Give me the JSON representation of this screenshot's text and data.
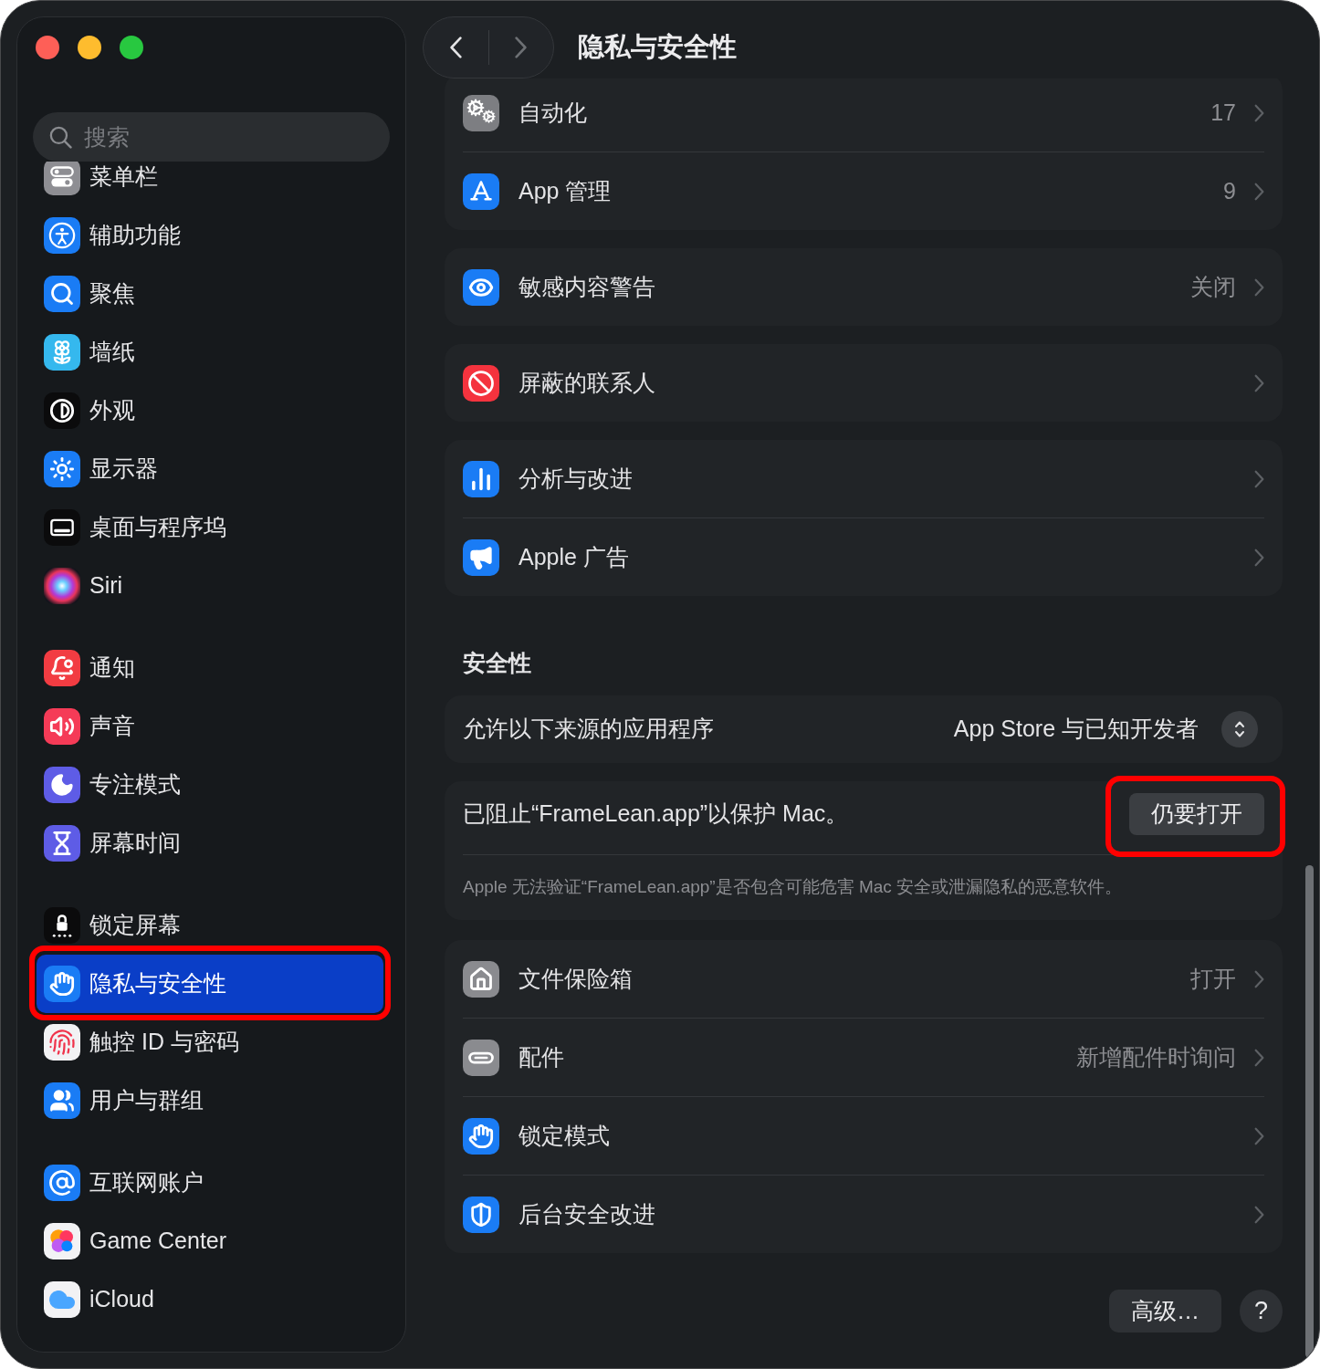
{
  "window": {
    "title": "隐私与安全性"
  },
  "sidebar": {
    "search": {
      "placeholder": "搜索"
    },
    "groups": [
      {
        "items": [
          {
            "label": "菜单栏",
            "selected": false,
            "highlighted": false
          },
          {
            "label": "辅助功能",
            "selected": false,
            "highlighted": false
          },
          {
            "label": "聚焦",
            "selected": false,
            "highlighted": false
          },
          {
            "label": "墙纸",
            "selected": false,
            "highlighted": false
          },
          {
            "label": "外观",
            "selected": false,
            "highlighted": false
          },
          {
            "label": "显示器",
            "selected": false,
            "highlighted": false
          },
          {
            "label": "桌面与程序坞",
            "selected": false,
            "highlighted": false
          },
          {
            "label": "Siri",
            "selected": false,
            "highlighted": false
          }
        ]
      },
      {
        "items": [
          {
            "label": "通知",
            "selected": false,
            "highlighted": false
          },
          {
            "label": "声音",
            "selected": false,
            "highlighted": false
          },
          {
            "label": "专注模式",
            "selected": false,
            "highlighted": false
          },
          {
            "label": "屏幕时间",
            "selected": false,
            "highlighted": false
          }
        ]
      },
      {
        "items": [
          {
            "label": "锁定屏幕",
            "selected": false,
            "highlighted": false
          },
          {
            "label": "隐私与安全性",
            "selected": true,
            "highlighted": true
          },
          {
            "label": "触控 ID 与密码",
            "selected": false,
            "highlighted": false
          },
          {
            "label": "用户与群组",
            "selected": false,
            "highlighted": false
          }
        ]
      },
      {
        "items": [
          {
            "label": "互联网账户",
            "selected": false,
            "highlighted": false
          },
          {
            "label": "Game Center",
            "selected": false,
            "highlighted": false
          },
          {
            "label": "iCloud",
            "selected": false,
            "highlighted": false
          }
        ]
      }
    ]
  },
  "content": {
    "privacy_groups": [
      {
        "rows": [
          {
            "label": "自动化",
            "value": "17"
          },
          {
            "label": "App 管理",
            "value": "9"
          }
        ]
      },
      {
        "rows": [
          {
            "label": "敏感内容警告",
            "value": "关闭"
          }
        ]
      },
      {
        "rows": [
          {
            "label": "屏蔽的联系人"
          }
        ]
      },
      {
        "rows": [
          {
            "label": "分析与改进"
          },
          {
            "label": "Apple 广告"
          }
        ]
      }
    ],
    "security": {
      "heading": "安全性",
      "app_source": {
        "label": "允许以下来源的应用程序",
        "value": "App Store 与已知开发者"
      },
      "blocked": {
        "message": "已阻止“FrameLean.app”以保护 Mac。",
        "button": {
          "label": "仍要打开",
          "highlighted": true
        },
        "detail": "Apple 无法验证“FrameLean.app”是否包含可能危害 Mac 安全或泄漏隐私的恶意软件。"
      },
      "groups": [
        {
          "rows": [
            {
              "label": "文件保险箱",
              "value": "打开"
            },
            {
              "label": "配件",
              "value": "新增配件时询问"
            },
            {
              "label": "锁定模式"
            },
            {
              "label": "后台安全改进"
            }
          ]
        }
      ]
    }
  },
  "footer": {
    "advanced_button": "高级…",
    "help_button": "?"
  }
}
